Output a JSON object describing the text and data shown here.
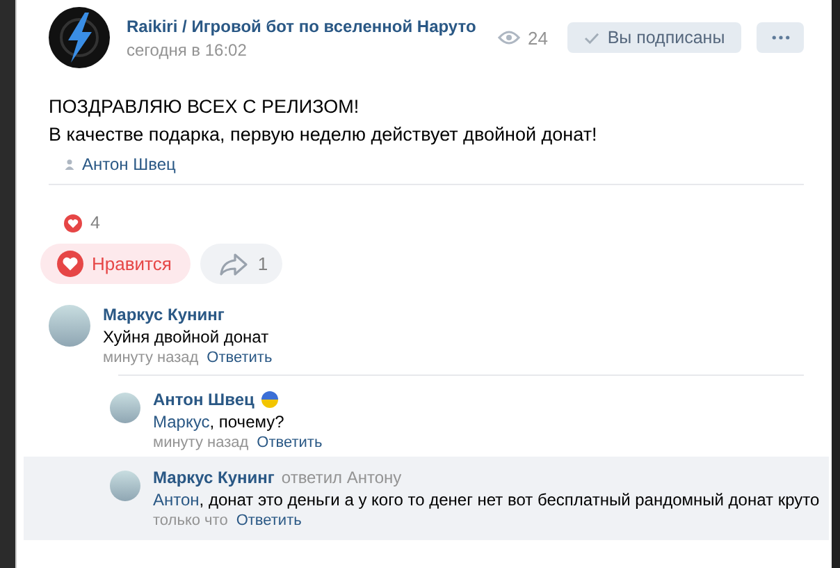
{
  "post": {
    "author": "Raikiri / Игровой бот по вселенной Наруто",
    "time": "сегодня в 16:02",
    "views": "24",
    "subscribe_button": "Вы подписаны",
    "text": [
      "ПОЗДРАВЛЯЮ ВСЕХ С РЕЛИЗОМ!",
      "В качестве подарка, первую неделю действует двойной донат!"
    ],
    "signer": "Антон Швец",
    "likes_count": "4",
    "like_button": {
      "label": "Нравится",
      "liked": true
    },
    "share_count": "1"
  },
  "comments": [
    {
      "name": "Маркус Кунинг",
      "text": "Хуйня двойной донат",
      "time": "минуту назад",
      "reply": "Ответить",
      "highlighted": false,
      "children": [
        {
          "name": "Антон Швец",
          "flag": true,
          "addressee": "Маркус",
          "text": ", почему?",
          "time": "минуту назад",
          "reply": "Ответить",
          "highlighted": false
        },
        {
          "name": "Маркус Кунинг",
          "replied_to": "ответил Антону",
          "addressee": "Антон",
          "text": ", донат это деньги а у кого то денег нет вот бесплатный рандомный донат круто",
          "time": "только что",
          "reply": "Ответить",
          "highlighted": true
        }
      ]
    }
  ]
}
